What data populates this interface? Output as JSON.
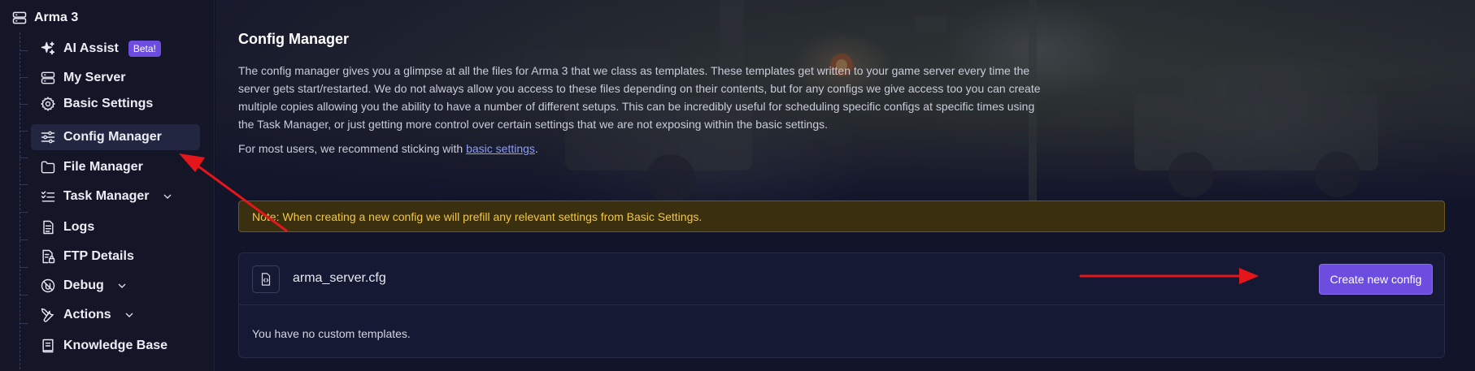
{
  "sidebar": {
    "game_title": "Arma 3",
    "items": [
      {
        "label": "AI Assist",
        "badge": "Beta!",
        "icon": "sparkles-icon"
      },
      {
        "label": "My Server",
        "icon": "server-icon"
      },
      {
        "label": "Basic Settings",
        "icon": "gear-icon"
      },
      {
        "label": "Config Manager",
        "icon": "sliders-icon",
        "active": true
      },
      {
        "label": "File Manager",
        "icon": "folder-icon"
      },
      {
        "label": "Task Manager",
        "icon": "checklist-icon",
        "expandable": true
      },
      {
        "label": "Logs",
        "icon": "document-icon"
      },
      {
        "label": "FTP Details",
        "icon": "file-lock-icon"
      },
      {
        "label": "Debug",
        "icon": "bug-icon",
        "expandable": true
      },
      {
        "label": "Actions",
        "icon": "tools-icon",
        "expandable": true
      },
      {
        "label": "Knowledge Base",
        "icon": "book-icon"
      }
    ]
  },
  "main": {
    "title": "Config Manager",
    "description": "The config manager gives you a glimpse at all the files for Arma 3 that we class as templates. These templates get written to your game server every time the server gets start/restarted. We do not always allow you access to these files depending on their contents, but for any configs we give access too you can create multiple copies allowing you the ability to have a number of different setups. This can be incredibly useful for scheduling specific configs at specific times using the Task Manager, or just getting more control over certain settings that we are not exposing within the basic settings.",
    "recommend_prefix": "For most users, we recommend sticking with ",
    "recommend_link": "basic settings",
    "recommend_suffix": ".",
    "note": "Note: When creating a new config we will prefill any relevant settings from Basic Settings.",
    "config_file": "arma_server.cfg",
    "create_button": "Create new config",
    "empty_message": "You have no custom templates."
  },
  "colors": {
    "accent": "#6d4de0",
    "note_text": "#f5c842",
    "annotation_arrow": "#e3161b"
  }
}
